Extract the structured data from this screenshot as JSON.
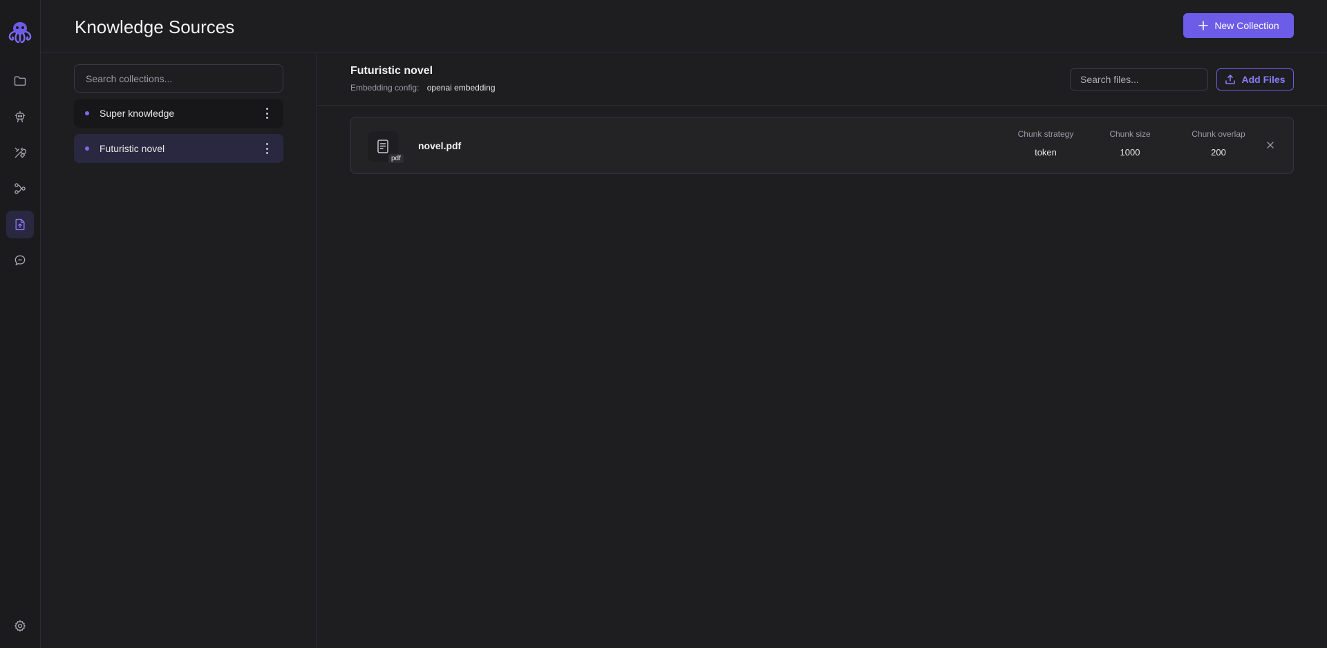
{
  "page": {
    "title": "Knowledge Sources",
    "new_collection_label": "New Collection"
  },
  "rail": {
    "items": [
      "folder-icon",
      "robot-icon",
      "tools-icon",
      "workflow-icon",
      "knowledge-file-icon",
      "chat-icon"
    ],
    "active": "knowledge-file-icon",
    "bottom": "gear-icon"
  },
  "collections": {
    "search_placeholder": "Search collections...",
    "items": [
      {
        "label": "Super knowledge",
        "selected": false
      },
      {
        "label": "Futuristic novel",
        "selected": true
      }
    ]
  },
  "main": {
    "collection_title": "Futuristic novel",
    "embedding_label": "Embedding config:",
    "embedding_value": "openai embedding",
    "search_files_placeholder": "Search files...",
    "add_files_label": "Add Files"
  },
  "files": [
    {
      "name": "novel.pdf",
      "ext": "pdf",
      "chunk_strategy_label": "Chunk strategy",
      "chunk_strategy": "token",
      "chunk_size_label": "Chunk size",
      "chunk_size": "1000",
      "chunk_overlap_label": "Chunk overlap",
      "chunk_overlap": "200"
    }
  ],
  "colors": {
    "accent": "#6c5ce7",
    "accent_text": "#8b7cff",
    "background": "#1e1e21",
    "selected_item": "#2a2840"
  }
}
